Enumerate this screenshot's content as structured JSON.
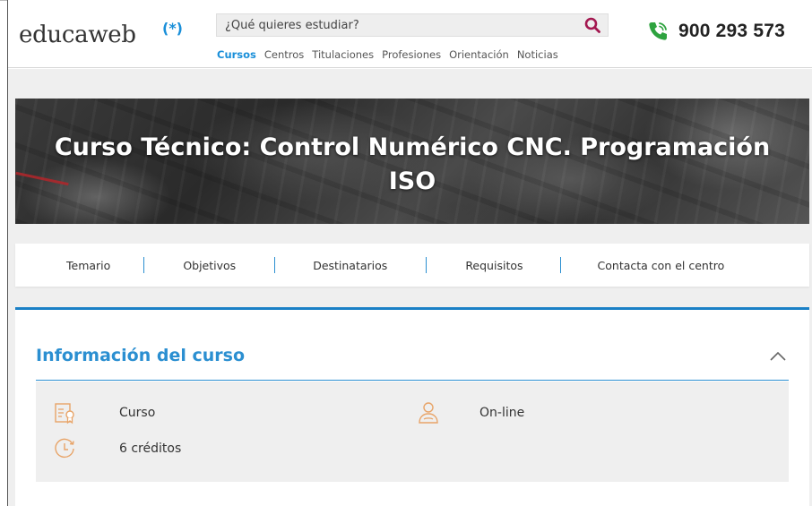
{
  "header": {
    "logo_text": "educaweb",
    "logo_mark": "(*)",
    "search_placeholder": "¿Qué quieres estudiar?",
    "nav": [
      "Cursos",
      "Centros",
      "Titulaciones",
      "Profesiones",
      "Orientación",
      "Noticias"
    ],
    "nav_active": "Cursos",
    "phone": "900 293 573"
  },
  "hero": {
    "title": "Curso Técnico: Control Numérico CNC. Programación ISO"
  },
  "tabs": [
    "Temario",
    "Objetivos",
    "Destinatarios",
    "Requisitos",
    "Contacta con el centro"
  ],
  "info": {
    "title": "Información del curso",
    "items": {
      "type": "Curso",
      "modality": "On-line",
      "credits": "6 créditos"
    }
  },
  "colors": {
    "accent_blue": "#2b8fd1",
    "search_icon": "#a3174f",
    "phone_icon": "#2ea33f",
    "icon_orange": "#e8a468"
  },
  "icons": {
    "search": "search-icon",
    "phone": "phone-icon",
    "collapse": "chevron-up-icon",
    "type": "certificate-icon",
    "modality": "user-icon",
    "credits": "clock-icon"
  }
}
